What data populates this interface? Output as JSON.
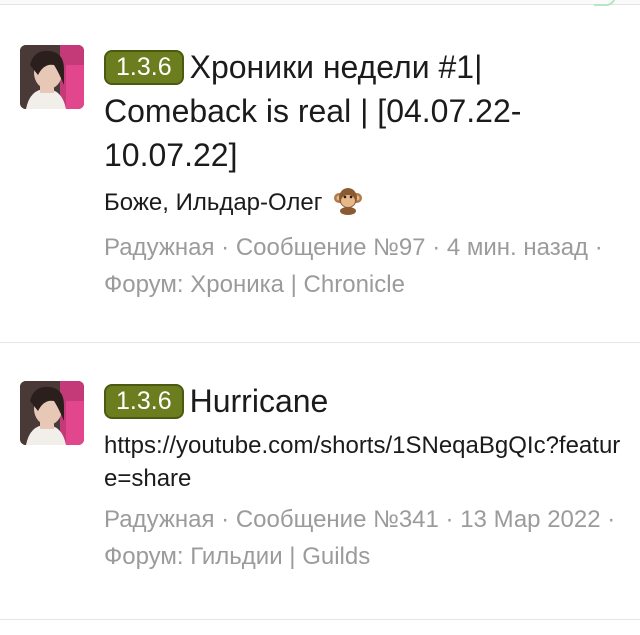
{
  "posts": [
    {
      "prefix": "1.3.6",
      "title": "Хроники недели #1| Comeback is real | [04.07.22-10.07.22]",
      "snippet": "Боже, Ильдар-Олег",
      "snippet_emoji": "monkey-icon",
      "meta": {
        "author": "Радужная",
        "sep1": " · ",
        "message": "Сообщение №97",
        "sep2": " · ",
        "time": "4 мин. назад",
        "sep3": " · ",
        "forum": "Форум: Хроника | Chronicle"
      }
    },
    {
      "prefix": "1.3.6",
      "title": "Hurricane",
      "snippet": "https://youtube.com/shorts/1SNeqaBgQIc?feature=share",
      "meta": {
        "author": "Радужная",
        "sep1": " · ",
        "message": "Сообщение №341",
        "sep2": " · ",
        "time": "13 Мар 2022",
        "sep3": " · ",
        "forum": "Форум: Гильдии | Guilds"
      }
    }
  ],
  "colors": {
    "prefix_bg": "#6b7d1f",
    "meta_text": "#9b9b9b"
  }
}
